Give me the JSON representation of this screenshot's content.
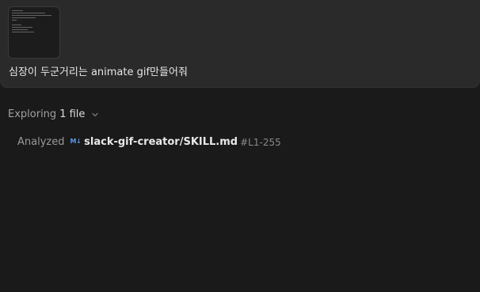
{
  "message": {
    "prompt": "심장이 두군거리는 animate gif만들어줘",
    "attachment_icon": "image-thumbnail"
  },
  "exploring": {
    "prefix": "Exploring",
    "count_label": "1 file",
    "chevron_icon": "chevron-down-icon"
  },
  "analyzed": {
    "label": "Analyzed",
    "file_icon": "markdown-icon",
    "file_icon_text": "M↓",
    "file_path": "slack-gif-creator/SKILL.md",
    "line_range": "#L1-255"
  },
  "colors": {
    "background": "#1a1a1a",
    "message_background": "#2a2a2a",
    "markdown_icon": "#5a9be6"
  }
}
